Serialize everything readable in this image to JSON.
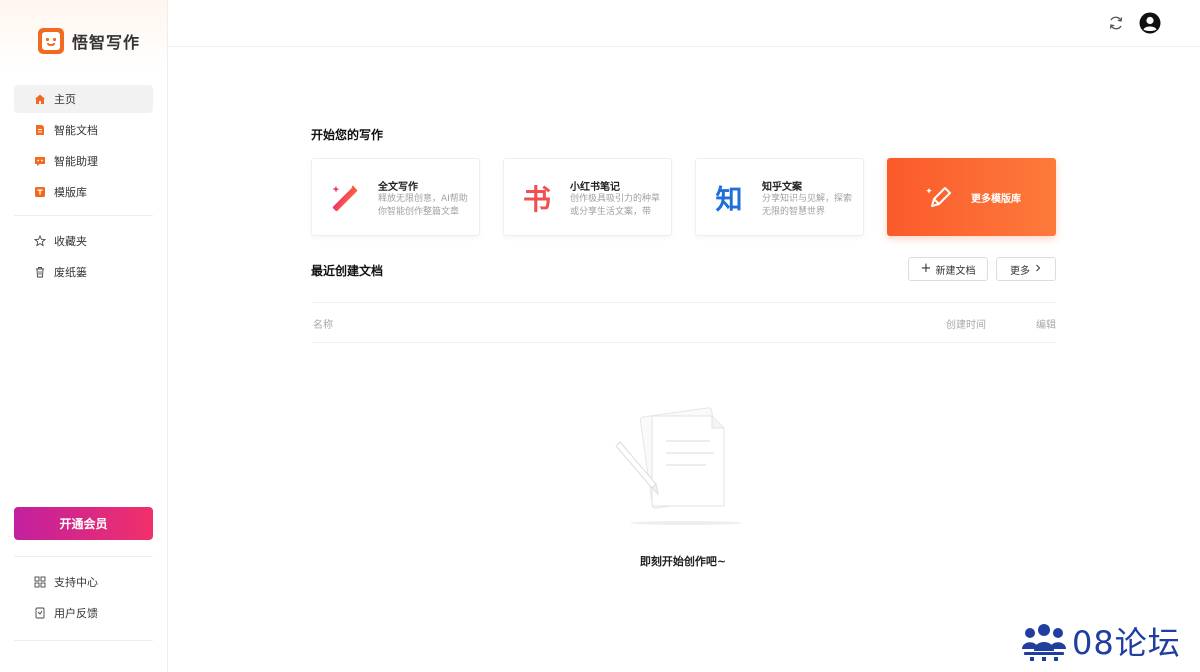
{
  "brand": {
    "name": "悟智写作"
  },
  "sidebar": {
    "main_items": [
      {
        "label": "主页",
        "icon": "home-icon",
        "active": true
      },
      {
        "label": "智能文档",
        "icon": "document-icon"
      },
      {
        "label": "智能助理",
        "icon": "assistant-icon"
      },
      {
        "label": "模版库",
        "icon": "template-icon"
      }
    ],
    "secondary_items": [
      {
        "label": "收藏夹",
        "icon": "star-icon"
      },
      {
        "label": "废纸篓",
        "icon": "trash-icon"
      }
    ],
    "vip_button": "开通会员",
    "bottom_items": [
      {
        "label": "支持中心",
        "icon": "grid-icon"
      },
      {
        "label": "用户反馈",
        "icon": "feedback-icon"
      }
    ]
  },
  "topbar": {
    "refresh_icon": "refresh-icon",
    "avatar_icon": "user-avatar-icon"
  },
  "main": {
    "start_title": "开始您的写作",
    "cards": [
      {
        "title": "全文写作",
        "desc": "释放无限创意，AI帮助你智能创作整篇文章",
        "icon": "magic-wand-icon"
      },
      {
        "title": "小红书笔记",
        "desc": "创作极具吸引力的种草或分享生活文案，带有...",
        "icon": "book-char-icon"
      },
      {
        "title": "知乎文案",
        "desc": "分享知识与见解，探索无限的智慧世界",
        "icon": "zhi-char-icon"
      }
    ],
    "more_templates": "更多模版库",
    "recent_title": "最近创建文档",
    "new_doc_button": "新建文档",
    "more_button": "更多",
    "table_headers": {
      "name": "名称",
      "created": "创建时间",
      "edit": "编辑"
    },
    "empty_text": "即刻开始创作吧~"
  },
  "watermark": {
    "text": "08论坛"
  },
  "colors": {
    "accent": "#f06a1f",
    "vip_start": "#c2209f",
    "vip_end": "#f0306a",
    "more_card": "#fb5a2a"
  }
}
